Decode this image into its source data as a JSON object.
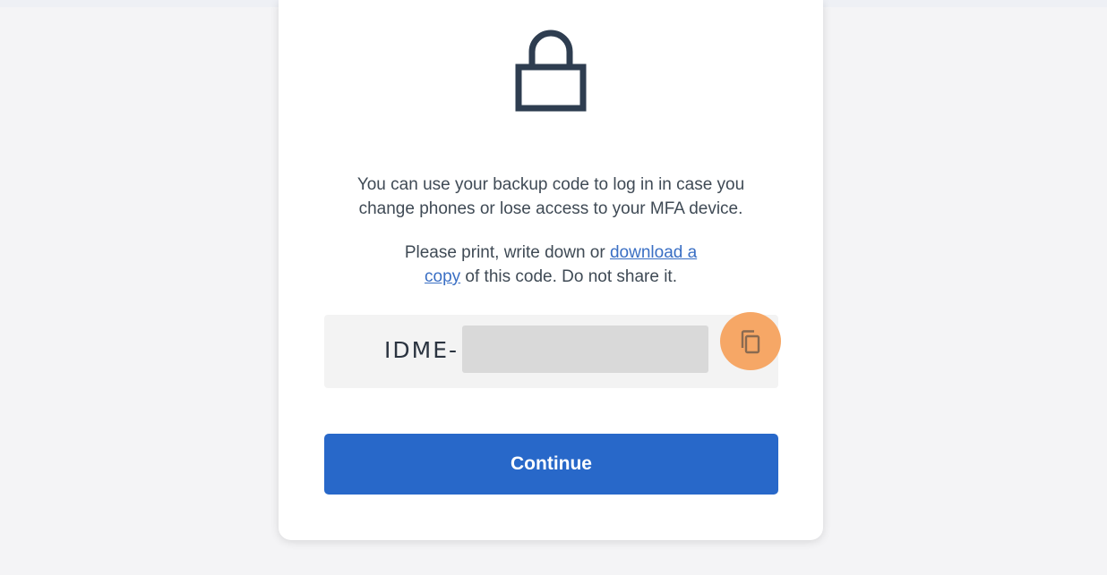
{
  "icons": {
    "lock": "lock-icon",
    "copy": "copy-icon"
  },
  "message": {
    "line1": "You can use your backup code to log in in case you",
    "line2": "change phones or lose access to your MFA device."
  },
  "instructions": {
    "before_link": "Please print, write down or ",
    "link_part1": "download a",
    "link_part2": "copy",
    "after_link": " of this code. Do not share it."
  },
  "backup_code": {
    "prefix": "IDME-"
  },
  "continue_label": "Continue",
  "colors": {
    "primary": "#2868c9",
    "link": "#3a6fc4",
    "copy_highlight": "#f6a766",
    "icon": "#2e3d50"
  }
}
